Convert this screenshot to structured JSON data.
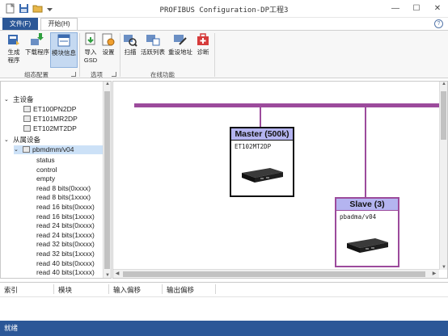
{
  "window": {
    "title": "PROFIBUS Configuration-DP工程3",
    "minimize": "—",
    "maximize": "☐",
    "close": "✕"
  },
  "tabs": {
    "file": "文件(F)",
    "home": "开始(H)"
  },
  "ribbon": {
    "group1": {
      "label": "组态配置",
      "generate": "生成\n程序",
      "download": "下载程序",
      "module_info": "模块信息"
    },
    "group2": {
      "label": "选项",
      "import_gsd": "导入\nGSD",
      "settings": "设置"
    },
    "group3": {
      "label": "在线功能",
      "scan": "扫描",
      "live_list": "活跃列表",
      "reset_addr": "重设地址",
      "diagnose": "诊断"
    }
  },
  "tree": {
    "master_group": "主设备",
    "masters": [
      "ET100PN2DP",
      "ET101MR2DP",
      "ET102MT2DP"
    ],
    "slave_group": "从属设备",
    "slave_device": "pbmdmm/v04",
    "modules": [
      "status",
      "control",
      "empty",
      "read 8 bits(0xxxx)",
      "read 8 bits(1xxxx)",
      "read 16 bits(0xxxx)",
      "read 16 bits(1xxxx)",
      "read 24 bits(0xxxx)",
      "read 24 bits(1xxxx)",
      "read 32 bits(0xxxx)",
      "read 32 bits(1xxxx)",
      "read 40 bits(0xxxx)",
      "read 40 bits(1xxxx)"
    ]
  },
  "canvas": {
    "bus_color": "#9c4b9c",
    "master": {
      "header": "Master (500k)",
      "name": "ET102MT2DP",
      "header_color": "#b4b4f0"
    },
    "slave": {
      "header": "Slave (3)",
      "name": "pbadma/v04",
      "header_color": "#b4b4f0"
    }
  },
  "bottom_table": {
    "columns": [
      "索引",
      "模块",
      "输入偏移",
      "输出偏移"
    ]
  },
  "status": {
    "text": "就绪"
  },
  "colors": {
    "accent": "#2b5797",
    "selection": "#cce1f7"
  }
}
